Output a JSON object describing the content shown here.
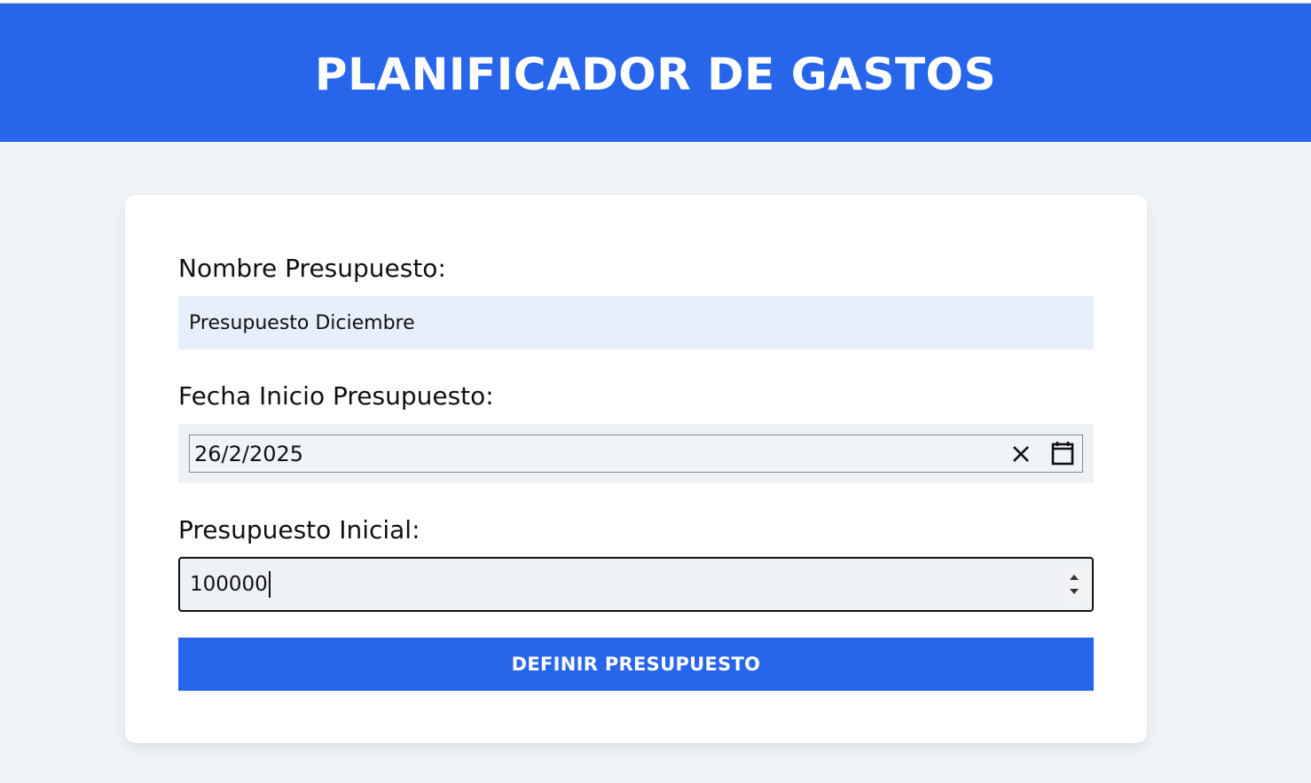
{
  "header": {
    "title": "PLANIFICADOR DE GASTOS"
  },
  "form": {
    "name_label": "Nombre Presupuesto:",
    "name_value": "Presupuesto Diciembre",
    "date_label": "Fecha Inicio Presupuesto:",
    "date_value": "26/2/2025",
    "amount_label": "Presupuesto Inicial:",
    "amount_value": "100000",
    "submit_label": "DEFINIR PRESUPUESTO"
  },
  "icons": {
    "clear": "close-icon",
    "calendar": "calendar-icon",
    "spin_up": "chevron-up-icon",
    "spin_down": "chevron-down-icon"
  },
  "colors": {
    "brand": "#2765eb",
    "page_bg": "#f0f4f9",
    "card_bg": "#ffffff",
    "name_field_bg": "#e8effc"
  }
}
